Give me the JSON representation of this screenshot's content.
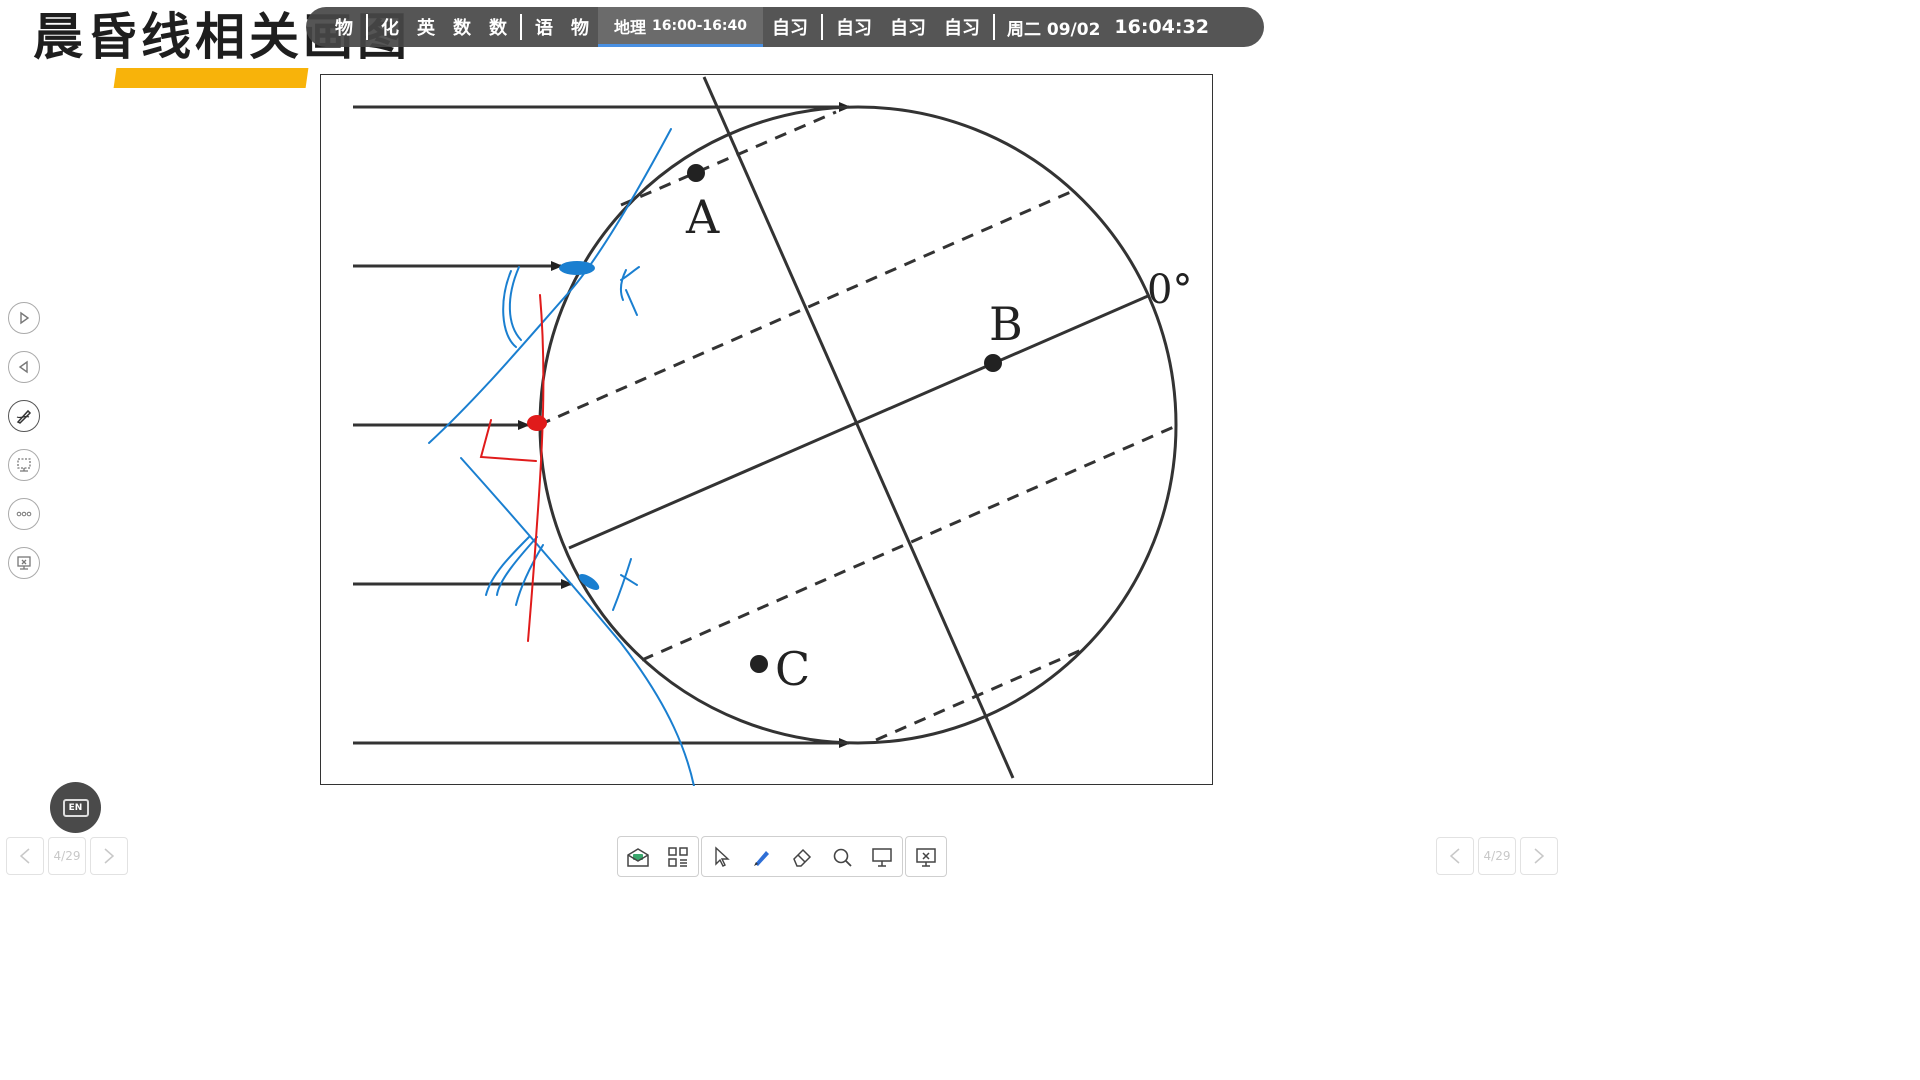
{
  "page": {
    "title": "晨昏线相关画图"
  },
  "schedule": {
    "slots": [
      {
        "label": "物"
      },
      {
        "label": "化"
      },
      {
        "label": "英"
      },
      {
        "label": "数"
      },
      {
        "label": "数"
      },
      {
        "label": "语"
      },
      {
        "label": "物"
      }
    ],
    "active": {
      "label": "地理",
      "time": "16:00-16:40"
    },
    "after": [
      {
        "label": "自习"
      },
      {
        "label": "自习"
      },
      {
        "label": "自习"
      },
      {
        "label": "自习"
      }
    ],
    "date": "周二 09/02",
    "clock": "16:04:32"
  },
  "figure": {
    "label_a": "A",
    "label_b": "B",
    "label_c": "C",
    "label_zero": "0°"
  },
  "annotation_colors": {
    "blue": "#1a7fd0",
    "red": "#e01b1b"
  },
  "lang_button": {
    "label": "EN"
  },
  "pager_left": {
    "page": "4/29"
  },
  "pager_right": {
    "page": "4/29"
  },
  "toolbar": {
    "icons": [
      "classroom-icon",
      "apps-grid-icon",
      "select-pointer-icon",
      "pen-icon",
      "eraser-icon",
      "search-icon",
      "whiteboard-icon",
      "close-presentation-icon"
    ]
  },
  "side_tools": [
    "play-next-icon",
    "play-prev-icon",
    "annotate-pen-icon",
    "screen-tool-icon",
    "more-icon",
    "exit-slide-icon"
  ]
}
